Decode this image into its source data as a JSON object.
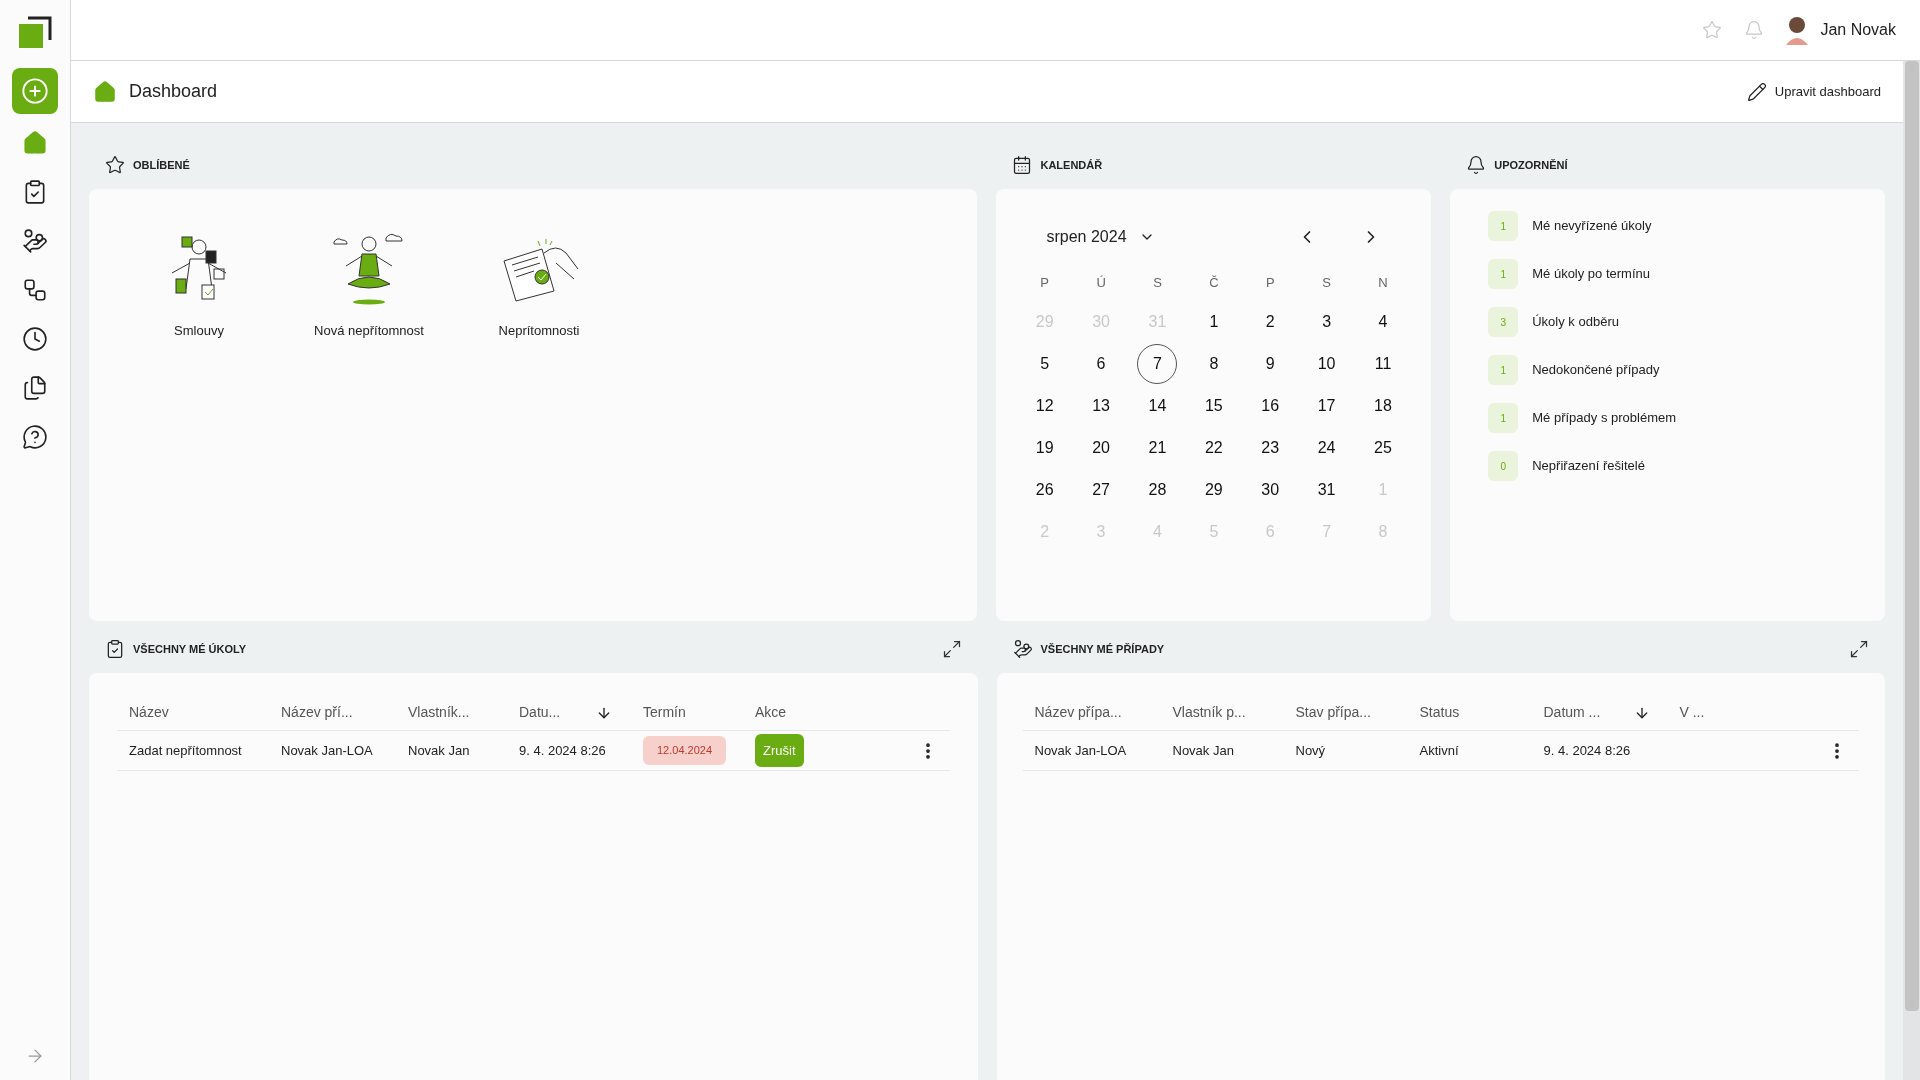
{
  "user": {
    "name": "Jan Novak"
  },
  "page_header": {
    "title": "Dashboard",
    "edit_button": "Upravit dashboard"
  },
  "favorites": {
    "title": "OBLÍBENÉ",
    "items": [
      {
        "kind": "contracts",
        "label": "Smlouvy"
      },
      {
        "kind": "meditation",
        "label": "Nová nepřítomnost"
      },
      {
        "kind": "document",
        "label": "Neprítomnosti"
      }
    ]
  },
  "calendar": {
    "title": "KALENDÁŘ",
    "month": "srpen 2024",
    "weekdays": [
      "P",
      "Ú",
      "S",
      "Č",
      "P",
      "S",
      "N"
    ],
    "days": [
      {
        "label": "29",
        "muted": true,
        "selected": false
      },
      {
        "label": "30",
        "muted": true,
        "selected": false
      },
      {
        "label": "31",
        "muted": true,
        "selected": false
      },
      {
        "label": "1",
        "muted": false,
        "selected": false
      },
      {
        "label": "2",
        "muted": false,
        "selected": false
      },
      {
        "label": "3",
        "muted": false,
        "selected": false
      },
      {
        "label": "4",
        "muted": false,
        "selected": false
      },
      {
        "label": "5",
        "muted": false,
        "selected": false
      },
      {
        "label": "6",
        "muted": false,
        "selected": false
      },
      {
        "label": "7",
        "muted": false,
        "selected": true
      },
      {
        "label": "8",
        "muted": false,
        "selected": false
      },
      {
        "label": "9",
        "muted": false,
        "selected": false
      },
      {
        "label": "10",
        "muted": false,
        "selected": false
      },
      {
        "label": "11",
        "muted": false,
        "selected": false
      },
      {
        "label": "12",
        "muted": false,
        "selected": false
      },
      {
        "label": "13",
        "muted": false,
        "selected": false
      },
      {
        "label": "14",
        "muted": false,
        "selected": false
      },
      {
        "label": "15",
        "muted": false,
        "selected": false
      },
      {
        "label": "16",
        "muted": false,
        "selected": false
      },
      {
        "label": "17",
        "muted": false,
        "selected": false
      },
      {
        "label": "18",
        "muted": false,
        "selected": false
      },
      {
        "label": "19",
        "muted": false,
        "selected": false
      },
      {
        "label": "20",
        "muted": false,
        "selected": false
      },
      {
        "label": "21",
        "muted": false,
        "selected": false
      },
      {
        "label": "22",
        "muted": false,
        "selected": false
      },
      {
        "label": "23",
        "muted": false,
        "selected": false
      },
      {
        "label": "24",
        "muted": false,
        "selected": false
      },
      {
        "label": "25",
        "muted": false,
        "selected": false
      },
      {
        "label": "26",
        "muted": false,
        "selected": false
      },
      {
        "label": "27",
        "muted": false,
        "selected": false
      },
      {
        "label": "28",
        "muted": false,
        "selected": false
      },
      {
        "label": "29",
        "muted": false,
        "selected": false
      },
      {
        "label": "30",
        "muted": false,
        "selected": false
      },
      {
        "label": "31",
        "muted": false,
        "selected": false
      },
      {
        "label": "1",
        "muted": true,
        "selected": false
      },
      {
        "label": "2",
        "muted": true,
        "selected": false
      },
      {
        "label": "3",
        "muted": true,
        "selected": false
      },
      {
        "label": "4",
        "muted": true,
        "selected": false
      },
      {
        "label": "5",
        "muted": true,
        "selected": false
      },
      {
        "label": "6",
        "muted": true,
        "selected": false
      },
      {
        "label": "7",
        "muted": true,
        "selected": false
      },
      {
        "label": "8",
        "muted": true,
        "selected": false
      }
    ]
  },
  "notifications": {
    "title": "UPOZORNĚNÍ",
    "items": [
      {
        "count": "1",
        "label": "Mé nevyřízené úkoly"
      },
      {
        "count": "1",
        "label": "Mé úkoly po termínu"
      },
      {
        "count": "3",
        "label": "Úkoly k odběru"
      },
      {
        "count": "1",
        "label": "Nedokončené případy"
      },
      {
        "count": "1",
        "label": "Mé případy s problémem"
      },
      {
        "count": "0",
        "label": "Nepřiřazení řešitelé"
      }
    ]
  },
  "tasks": {
    "title": "VŠECHNY MÉ ÚKOLY",
    "columns": [
      {
        "label": "Název",
        "sorted": false
      },
      {
        "label": "Název pří...",
        "sorted": false
      },
      {
        "label": "Vlastník...",
        "sorted": false
      },
      {
        "label": "Datu...",
        "sorted": true
      },
      {
        "label": "Termín",
        "sorted": false
      },
      {
        "label": "Akce",
        "sorted": false
      }
    ],
    "rows": [
      {
        "name": "Zadat nepřítomnost",
        "case_name": "Novak Jan-LOA",
        "owner": "Novak Jan",
        "date": "9. 4. 2024 8:26",
        "deadline": "12.04.2024",
        "action": "Zrušit"
      }
    ]
  },
  "cases": {
    "title": "VŠECHNY MÉ PŘÍPADY",
    "columns": [
      {
        "label": "Název přípa...",
        "sorted": false
      },
      {
        "label": "Vlastník p...",
        "sorted": false
      },
      {
        "label": "Stav přípa...",
        "sorted": false
      },
      {
        "label": "Status",
        "sorted": false
      },
      {
        "label": "Datum ...",
        "sorted": true
      },
      {
        "label": "V ...",
        "sorted": false
      }
    ],
    "rows": [
      {
        "cells": [
          "Novak Jan-LOA",
          "Novak Jan",
          "Nový",
          "Aktivní",
          "9. 4. 2024 8:26",
          ""
        ]
      }
    ]
  }
}
